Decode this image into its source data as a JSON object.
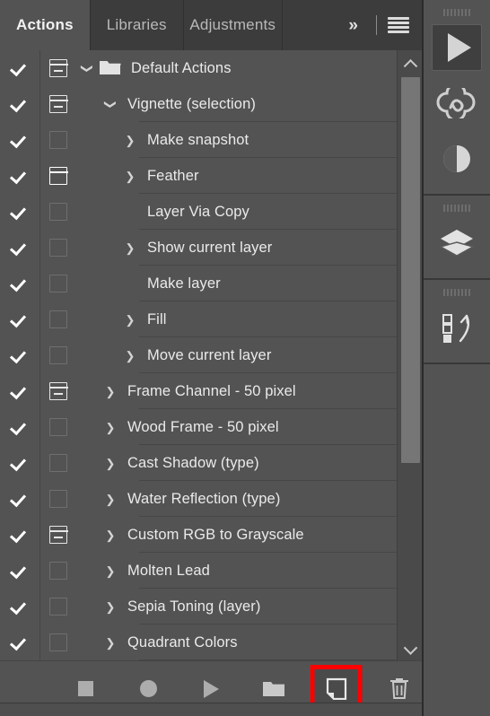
{
  "panel": {
    "tabs": [
      {
        "label": "Actions",
        "active": true
      },
      {
        "label": "Libraries",
        "active": false
      },
      {
        "label": "Adjustments",
        "active": false
      }
    ],
    "overflow_label": "»",
    "menu_icon": "hamburger-menu-icon"
  },
  "list": {
    "rows": [
      {
        "label": "Default Actions",
        "checked": true,
        "dialog": "partial",
        "arrow": "down",
        "indent": "a",
        "folder": true,
        "separator": false
      },
      {
        "label": "Vignette (selection)",
        "checked": true,
        "dialog": "partial",
        "arrow": "down",
        "indent": "b",
        "folder": false,
        "separator": true
      },
      {
        "label": "Make snapshot",
        "checked": true,
        "dialog": "off",
        "arrow": "right",
        "indent": "c",
        "folder": false,
        "separator": true
      },
      {
        "label": "Feather",
        "checked": true,
        "dialog": "on",
        "arrow": "right",
        "indent": "c",
        "folder": false,
        "separator": true
      },
      {
        "label": "Layer Via Copy",
        "checked": true,
        "dialog": "off",
        "arrow": "blank",
        "indent": "c",
        "folder": false,
        "separator": true
      },
      {
        "label": "Show current layer",
        "checked": true,
        "dialog": "off",
        "arrow": "right",
        "indent": "c",
        "folder": false,
        "separator": true
      },
      {
        "label": "Make layer",
        "checked": true,
        "dialog": "off",
        "arrow": "blank",
        "indent": "c",
        "folder": false,
        "separator": true
      },
      {
        "label": "Fill",
        "checked": true,
        "dialog": "off",
        "arrow": "right",
        "indent": "c",
        "folder": false,
        "separator": true
      },
      {
        "label": "Move current layer",
        "checked": true,
        "dialog": "off",
        "arrow": "right",
        "indent": "c",
        "folder": false,
        "separator": true
      },
      {
        "label": "Frame Channel - 50 pixel",
        "checked": true,
        "dialog": "partial",
        "arrow": "right",
        "indent": "b",
        "folder": false,
        "separator": true
      },
      {
        "label": "Wood Frame - 50 pixel",
        "checked": true,
        "dialog": "off",
        "arrow": "right",
        "indent": "b",
        "folder": false,
        "separator": true
      },
      {
        "label": "Cast Shadow (type)",
        "checked": true,
        "dialog": "off",
        "arrow": "right",
        "indent": "b",
        "folder": false,
        "separator": true
      },
      {
        "label": "Water Reflection (type)",
        "checked": true,
        "dialog": "off",
        "arrow": "right",
        "indent": "b",
        "folder": false,
        "separator": true
      },
      {
        "label": "Custom RGB to Grayscale",
        "checked": true,
        "dialog": "partial",
        "arrow": "right",
        "indent": "b",
        "folder": false,
        "separator": true
      },
      {
        "label": "Molten Lead",
        "checked": true,
        "dialog": "off",
        "arrow": "right",
        "indent": "b",
        "folder": false,
        "separator": true
      },
      {
        "label": "Sepia Toning (layer)",
        "checked": true,
        "dialog": "off",
        "arrow": "right",
        "indent": "b",
        "folder": false,
        "separator": true
      },
      {
        "label": "Quadrant Colors",
        "checked": true,
        "dialog": "off",
        "arrow": "right",
        "indent": "b",
        "folder": false,
        "separator": true
      }
    ]
  },
  "scrollbar": {
    "up_icon": "chevron-up-icon",
    "down_icon": "chevron-down-icon"
  },
  "toolbar": {
    "buttons": [
      {
        "name": "stop-playing-button",
        "icon": "stop-square-icon",
        "highlighted": false
      },
      {
        "name": "begin-recording-button",
        "icon": "record-circle-icon",
        "highlighted": false
      },
      {
        "name": "play-selection-button",
        "icon": "play-triangle-icon",
        "highlighted": false
      },
      {
        "name": "create-new-set-button",
        "icon": "folder-icon",
        "highlighted": false
      },
      {
        "name": "create-new-action-button",
        "icon": "new-page-icon",
        "highlighted": true
      },
      {
        "name": "delete-button",
        "icon": "trash-icon",
        "highlighted": false
      }
    ],
    "highlight_color": "#ff0000"
  },
  "rail": {
    "items": [
      {
        "name": "actions-play-icon",
        "icon": "play-triangle-icon",
        "selected": true
      },
      {
        "name": "creative-cloud-icon",
        "icon": "creative-cloud-icon",
        "selected": false
      },
      {
        "name": "adjustments-icon",
        "icon": "half-circle-icon",
        "selected": false
      },
      {
        "name": "layers-icon",
        "icon": "layers-diamond-icon",
        "selected": false
      },
      {
        "name": "actions-panel-icon",
        "icon": "actions-squares-arrow-icon",
        "selected": false
      }
    ]
  }
}
